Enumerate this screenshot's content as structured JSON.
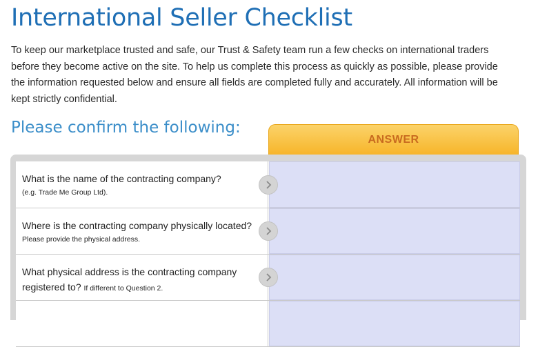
{
  "page": {
    "title": "International Seller Checklist",
    "intro": "To keep our marketplace trusted and safe, our Trust & Safety team run a few checks on international traders before they become active on the site. To help us complete this process as quickly as possible, please provide the information requested below and ensure all fields are completed fully and accurately. All information will be kept strictly confidential.",
    "subtitle": "Please confirm the following:"
  },
  "table": {
    "answer_header": "ANSWER",
    "rows": [
      {
        "question": "What is the name of the contracting company?",
        "hint": "(e.g. Trade Me Group Ltd).",
        "answer": ""
      },
      {
        "question": "Where is the contracting company physically located?",
        "hint": "Please provide the physical address.",
        "answer": ""
      },
      {
        "question": "What physical address is the contracting company registered to?",
        "hint": "If different to Question 2.",
        "answer": ""
      }
    ]
  },
  "colors": {
    "title": "#1f6fb5",
    "subtitle": "#3b8ec9",
    "answer_header_bg": "#f7b52a",
    "answer_header_text": "#c86a1f",
    "answer_cell_bg": "#dcdff6"
  },
  "icons": {
    "row_arrow": "chevron-right-icon"
  }
}
